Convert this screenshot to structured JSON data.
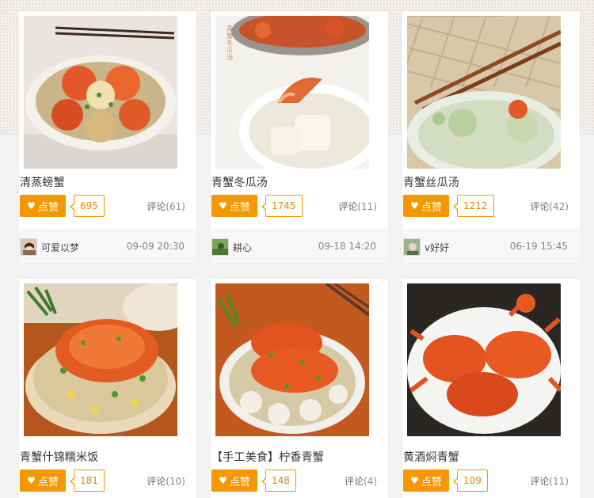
{
  "cards": [
    {
      "title": "清蒸螃蟹",
      "like_label": "点赞",
      "likes": "695",
      "comments_label": "评论",
      "comments": "(61)",
      "author": "可爱以梦",
      "date": "09-09 20:30"
    },
    {
      "title": "青蟹冬瓜汤",
      "like_label": "点赞",
      "likes": "1745",
      "comments_label": "评论",
      "comments": "(11)",
      "author": "耕心",
      "date": "09-18 14:20",
      "photo_watermark": "青蟹冬瓜汤"
    },
    {
      "title": "青蟹丝瓜汤",
      "like_label": "点赞",
      "likes": "1212",
      "comments_label": "评论",
      "comments": "(42)",
      "author": "v好好",
      "date": "06-19 15:45"
    },
    {
      "title": "青蟹什锦糯米饭",
      "like_label": "点赞",
      "likes": "181",
      "comments_label": "评论",
      "comments": "(10)"
    },
    {
      "title": "【手工美食】柠香青蟹",
      "like_label": "点赞",
      "likes": "148",
      "comments_label": "评论",
      "comments": "(4)"
    },
    {
      "title": "黄酒焖青蟹",
      "like_label": "点赞",
      "likes": "109",
      "comments_label": "评论",
      "comments": "(11)"
    }
  ],
  "colors": {
    "accent": "#f39800",
    "count_text": "#e8860a",
    "title_text": "#333333"
  },
  "icons": {
    "like": "heart-icon"
  }
}
